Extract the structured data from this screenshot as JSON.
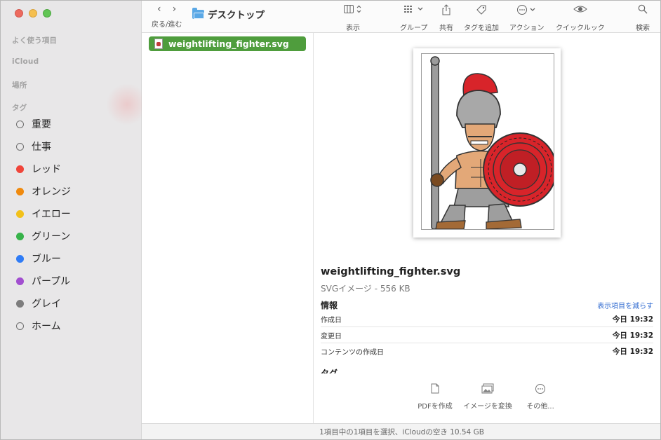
{
  "window": {
    "title": "デスクトップ"
  },
  "sidebar": {
    "sections": {
      "favorites": "よく使う項目",
      "icloud": "iCloud",
      "locations": "場所",
      "tags": "タグ"
    },
    "tags": [
      {
        "label": "重要",
        "color": "",
        "icon": "hollow-circle-icon"
      },
      {
        "label": "仕事",
        "color": "",
        "icon": "hollow-circle-icon"
      },
      {
        "label": "レッド",
        "color": "#f0453a"
      },
      {
        "label": "オレンジ",
        "color": "#f08a0e"
      },
      {
        "label": "イエロー",
        "color": "#f2c11a"
      },
      {
        "label": "グリーン",
        "color": "#37b34a"
      },
      {
        "label": "ブルー",
        "color": "#2f7cf6"
      },
      {
        "label": "パープル",
        "color": "#a24fd0"
      },
      {
        "label": "グレイ",
        "color": "#7d7d7d"
      },
      {
        "label": "ホーム",
        "color": "",
        "icon": "hollow-circle-icon"
      }
    ]
  },
  "toolbar": {
    "nav_label": "戻る/進む",
    "title": "デスクトップ",
    "buttons": {
      "view": "表示",
      "group": "グループ",
      "share": "共有",
      "tag": "タグを追加",
      "action": "アクション",
      "quicklook": "クイックルック",
      "search": "検索"
    }
  },
  "file_list": {
    "selected_file": "weightlifting_fighter.svg",
    "selection_color": "#4f9d3d"
  },
  "preview": {
    "name": "weightlifting_fighter.svg",
    "kind": "SVGイメージ - 556 KB",
    "info_heading": "情報",
    "show_less": "表示項目を減らす",
    "info": [
      {
        "label": "作成日",
        "value": "今日 19:32"
      },
      {
        "label": "変更日",
        "value": "今日 19:32"
      },
      {
        "label": "コンテンツの作成日",
        "value": "今日 19:32"
      }
    ],
    "tags_heading": "タグ",
    "quick_actions": [
      {
        "label": "PDFを作成",
        "icon": "document-icon"
      },
      {
        "label": "イメージを変換",
        "icon": "photos-icon"
      },
      {
        "label": "その他...",
        "icon": "more-icon"
      }
    ]
  },
  "status_bar": "1項目中の1項目を選択、iCloudの空き 10.54 GB"
}
